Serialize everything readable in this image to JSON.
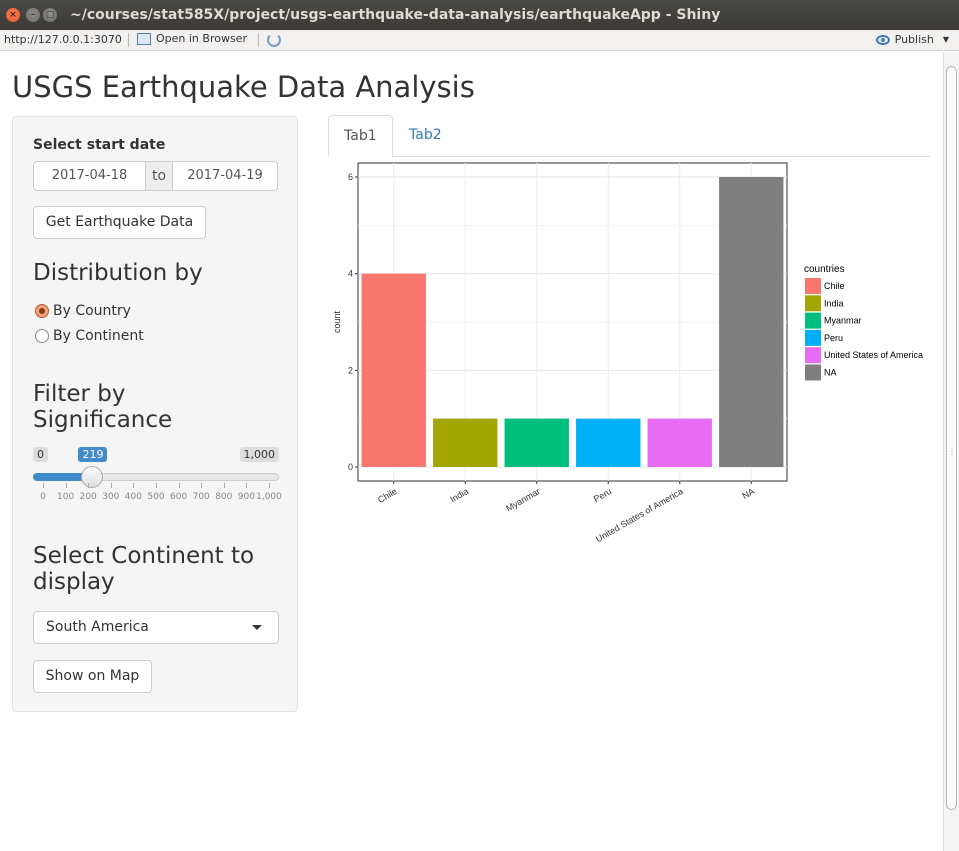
{
  "window": {
    "title": "~/courses/stat585X/project/usgs-earthquake-data-analysis/earthquakeApp - Shiny",
    "close_glyph": "×",
    "min_glyph": "–",
    "max_glyph": "□"
  },
  "urlbar": {
    "url": "http://127.0.0.1:3070",
    "open_browser": "Open in Browser",
    "publish": "Publish"
  },
  "app": {
    "title": "USGS Earthquake Data Analysis"
  },
  "sidebar": {
    "start_date_label": "Select start date",
    "date_start": "2017-04-18",
    "date_to": "to",
    "date_end": "2017-04-19",
    "get_data_button": "Get Earthquake Data",
    "distribution_heading": "Distribution by",
    "radio_country": "By Country",
    "radio_continent": "By Continent",
    "filter_heading": "Filter by Significance",
    "slider": {
      "min_label": "0",
      "max_label": "1,000",
      "value_label": "219",
      "value": 219,
      "min": 0,
      "max": 1000,
      "ticks": [
        "0",
        "100",
        "200",
        "300",
        "400",
        "500",
        "600",
        "700",
        "800",
        "900",
        "1,000"
      ]
    },
    "continent_heading": "Select Continent to display",
    "continent_selected": "South America",
    "show_map_button": "Show on Map"
  },
  "tabs": [
    {
      "label": "Tab1",
      "active": true
    },
    {
      "label": "Tab2",
      "active": false
    }
  ],
  "colors": {
    "accent": "#428bca",
    "tab_link": "#337ab7"
  },
  "chart_data": {
    "type": "bar",
    "categories": [
      "Chile",
      "India",
      "Myanmar",
      "Peru",
      "United States of America",
      "NA"
    ],
    "values": [
      4,
      1,
      1,
      1,
      1,
      6
    ],
    "colors": [
      "#F8766D",
      "#A3A500",
      "#00BF7D",
      "#00B0F6",
      "#E76BF3",
      "#7F7F7F"
    ],
    "ylabel": "count",
    "xlabel": "",
    "ylim": [
      0,
      6
    ],
    "yticks": [
      "0",
      "2",
      "4",
      "6"
    ],
    "grid": true,
    "legend": {
      "title": "countries",
      "position": "right",
      "entries": [
        "Chile",
        "India",
        "Myanmar",
        "Peru",
        "United States of America",
        "NA"
      ]
    }
  }
}
